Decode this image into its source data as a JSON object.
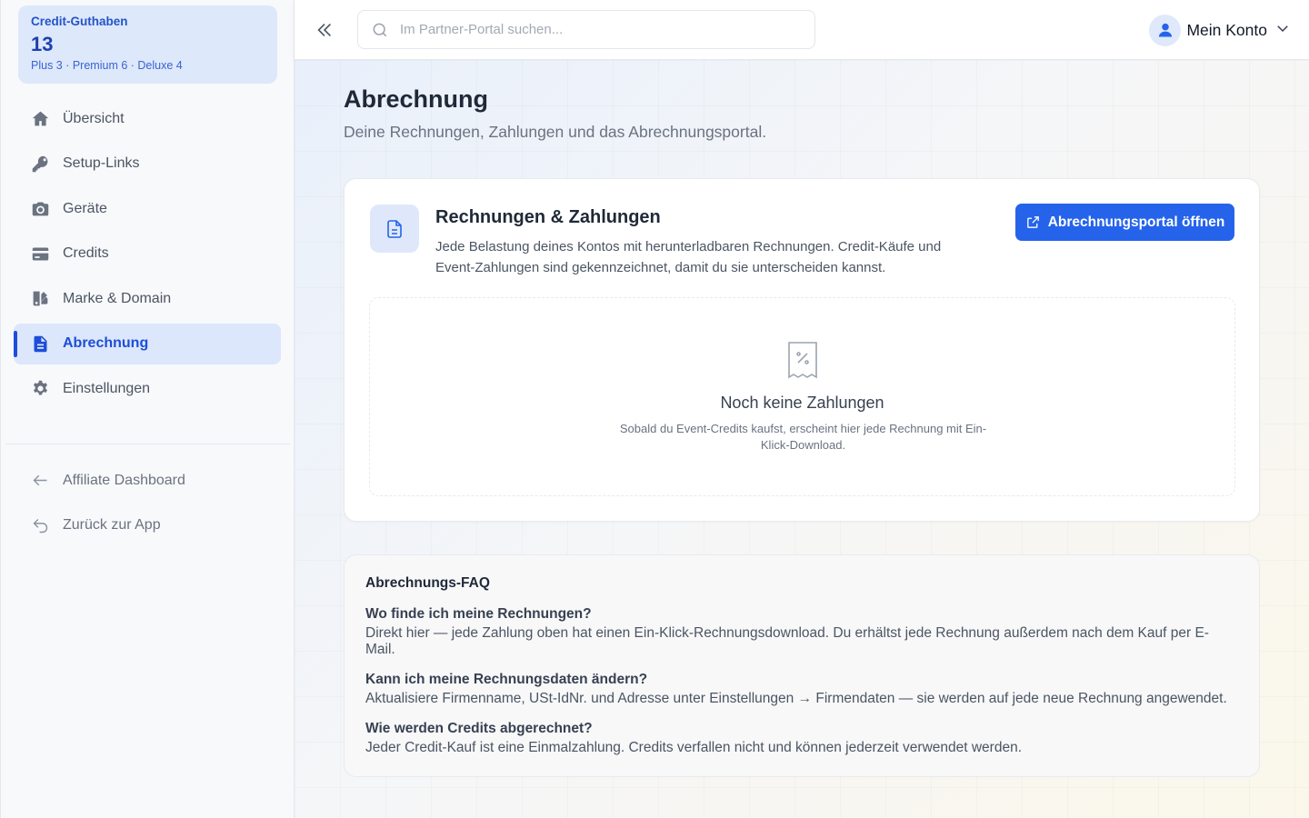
{
  "credit": {
    "label": "Credit-Guthaben",
    "count": "13",
    "tiers": "Plus 3 · Premium 6 · Deluxe 4"
  },
  "sidebar": {
    "items": [
      {
        "label": "Übersicht",
        "icon": "home-icon"
      },
      {
        "label": "Setup-Links",
        "icon": "key-icon"
      },
      {
        "label": "Geräte",
        "icon": "camera-icon"
      },
      {
        "label": "Credits",
        "icon": "credit-card-icon"
      },
      {
        "label": "Marke & Domain",
        "icon": "brand-icon"
      },
      {
        "label": "Abrechnung",
        "icon": "invoice-icon",
        "active": true
      },
      {
        "label": "Einstellungen",
        "icon": "gear-icon"
      }
    ],
    "secondary": [
      {
        "label": "Affiliate Dashboard",
        "icon": "arrow-left-icon"
      },
      {
        "label": "Zurück zur App",
        "icon": "undo-icon"
      }
    ]
  },
  "topbar": {
    "search_placeholder": "Im Partner-Portal suchen...",
    "account_label": "Mein Konto"
  },
  "page": {
    "title": "Abrechnung",
    "subtitle": "Deine Rechnungen, Zahlungen und das Abrechnungsportal."
  },
  "invoices": {
    "title": "Rechnungen & Zahlungen",
    "description": "Jede Belastung deines Kontos mit herunterladbaren Rechnungen. Credit-Käufe und Event-Zahlungen sind gekennzeichnet, damit du sie unterscheiden kannst.",
    "portal_button": "Abrechnungsportal öffnen",
    "empty_title": "Noch keine Zahlungen",
    "empty_desc": "Sobald du Event-Credits kaufst, erscheint hier jede Rechnung mit Ein-Klick-Download."
  },
  "faq": {
    "title": "Abrechnungs-FAQ",
    "items": [
      {
        "q": "Wo finde ich meine Rechnungen?",
        "a": "Direkt hier — jede Zahlung oben hat einen Ein-Klick-Rechnungsdownload. Du erhältst jede Rechnung außerdem nach dem Kauf per E-Mail."
      },
      {
        "q": "Kann ich meine Rechnungsdaten ändern?",
        "a": "Aktualisiere Firmenname, USt-IdNr. und Adresse unter Einstellungen → Firmendaten — sie werden auf jede neue Rechnung angewendet."
      },
      {
        "q": "Wie werden Credits abgerechnet?",
        "a": "Jeder Credit-Kauf ist eine Einmalzahlung. Credits verfallen nicht und können jederzeit verwendet werden."
      }
    ]
  },
  "colors": {
    "accent": "#2563eb",
    "active_bg": "#dce7fb"
  }
}
